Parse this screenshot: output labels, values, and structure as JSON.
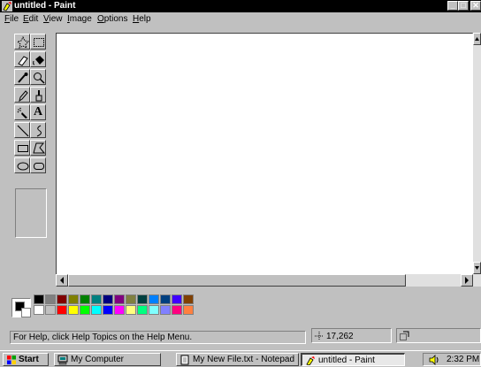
{
  "window": {
    "title": "untitled - Paint",
    "controls": {
      "minimize": "_",
      "maximize": "□",
      "close": "✕"
    }
  },
  "menu": [
    {
      "accel": "F",
      "rest": "ile"
    },
    {
      "accel": "E",
      "rest": "dit"
    },
    {
      "accel": "V",
      "rest": "iew"
    },
    {
      "accel": "I",
      "rest": "mage"
    },
    {
      "accel": "O",
      "rest": "ptions"
    },
    {
      "accel": "H",
      "rest": "elp"
    }
  ],
  "tools": [
    {
      "name": "free-form-select",
      "icon": "star-select-icon"
    },
    {
      "name": "select",
      "icon": "rect-select-icon"
    },
    {
      "name": "eraser",
      "icon": "eraser-icon"
    },
    {
      "name": "fill",
      "icon": "paint-bucket-icon"
    },
    {
      "name": "pick-color",
      "icon": "eyedropper-icon"
    },
    {
      "name": "magnifier",
      "icon": "magnifier-icon"
    },
    {
      "name": "pencil",
      "icon": "pencil-icon"
    },
    {
      "name": "brush",
      "icon": "brush-icon"
    },
    {
      "name": "airbrush",
      "icon": "airbrush-icon"
    },
    {
      "name": "text",
      "icon": "text-icon",
      "glyph": "A"
    },
    {
      "name": "line",
      "icon": "line-icon"
    },
    {
      "name": "curve",
      "icon": "curve-icon"
    },
    {
      "name": "rectangle",
      "icon": "rectangle-icon"
    },
    {
      "name": "polygon",
      "icon": "polygon-icon"
    },
    {
      "name": "ellipse",
      "icon": "ellipse-icon"
    },
    {
      "name": "rounded-rectangle",
      "icon": "rounded-rectangle-icon"
    }
  ],
  "palette": {
    "foreground": "#000000",
    "background": "#ffffff",
    "top_row": [
      "#000000",
      "#808080",
      "#800000",
      "#808000",
      "#008000",
      "#008080",
      "#000080",
      "#800080",
      "#808040",
      "#004040",
      "#0080ff",
      "#004080",
      "#4000ff",
      "#804000"
    ],
    "bottom_row": [
      "#ffffff",
      "#c0c0c0",
      "#ff0000",
      "#ffff00",
      "#00ff00",
      "#00ffff",
      "#0000ff",
      "#ff00ff",
      "#ffff80",
      "#00ff80",
      "#80ffff",
      "#8080ff",
      "#ff0080",
      "#ff8040"
    ]
  },
  "status": {
    "help_text": "For Help, click Help Topics on the Help Menu.",
    "coordinates": "17,262"
  },
  "taskbar": {
    "start_label": "Start",
    "tasks": [
      {
        "label": "My Computer",
        "icon": "computer-icon"
      },
      {
        "label": "My New File.txt - Notepad",
        "icon": "notepad-icon"
      },
      {
        "label": "untitled - Paint",
        "icon": "paint-icon",
        "active": true
      }
    ],
    "clock": "2:32 PM"
  }
}
